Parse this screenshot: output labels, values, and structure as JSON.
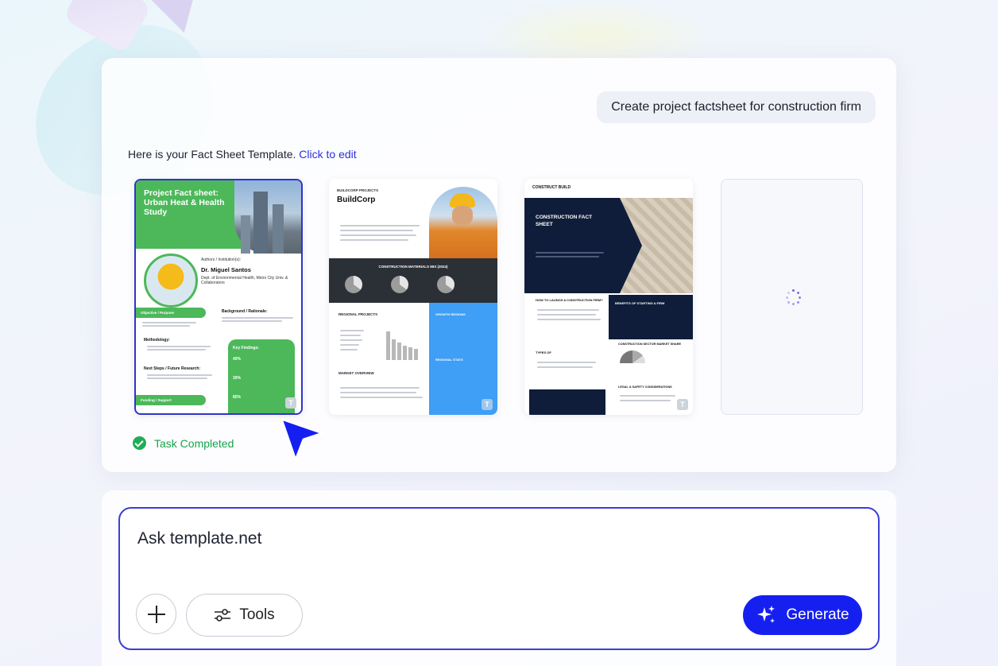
{
  "prompt": {
    "text": "Create project factsheet for construction firm"
  },
  "response": {
    "intro": "Here is your Fact Sheet Template.",
    "link": "Click to edit"
  },
  "templates": [
    {
      "title": "Project Fact sheet: Urban Heat & Health Study",
      "author_heading": "Authors / Institution(s):",
      "author_name": "Dr. Miguel Santos",
      "dept": "Dept. of Environmental Health, Metro City Univ. & Collaborators",
      "section1": "Objective / Purpose",
      "section2": "Background / Rationale:",
      "section3": "Methodology:",
      "section4": "Key Findings:",
      "stat1": "40%",
      "stat2": "30%",
      "stat3": "85%",
      "section5": "Next Steps / Future Research:",
      "section6": "Funding / Support"
    },
    {
      "brand_label": "BUILDCORP PROJECTS",
      "brand": "BuildCorp",
      "band_title": "CONSTRUCTION MATERIALS MIX (2024)",
      "section1": "REGIONAL PROJECTS",
      "section2": "MARKET OVERVIEW",
      "blue1": "GROWTH REGIONS",
      "blue2": "REGIONAL STATS"
    },
    {
      "label": "CONSTRUCT BUILD",
      "title": "CONSTRUCTION FACT SHEET",
      "section1": "HOW TO LAUNCH A CONSTRUCTION FIRM?",
      "section2": "BENEFITS OF STARTING A FIRM",
      "section3": "TYPES OF",
      "section4": "CONSTRUCTION SECTOR MARKET SHARE",
      "section5": "LEGAL & SAFETY CONSIDERATIONS"
    }
  ],
  "brand_mark": "T",
  "status": {
    "text": "Task Completed",
    "color": "#17a34a"
  },
  "composer": {
    "placeholder": "Ask template.net",
    "tools_label": "Tools",
    "generate_label": "Generate"
  },
  "colors": {
    "accent": "#1520f0",
    "border": "#3b3fd3"
  }
}
